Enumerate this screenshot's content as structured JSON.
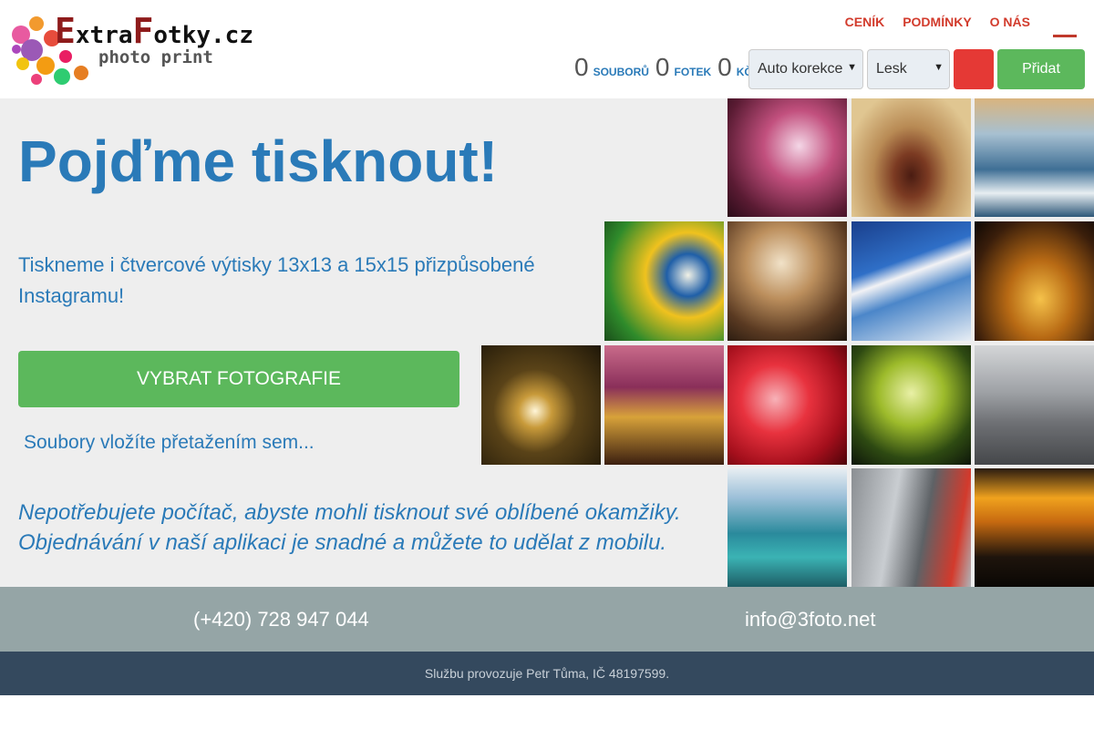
{
  "header": {
    "logo": {
      "wordmark_e": "E",
      "wordmark_xtra": "xtra",
      "wordmark_f": "F",
      "wordmark_rest": "otky.cz",
      "tagline": "photo print"
    },
    "nav": [
      {
        "label": "CENÍK"
      },
      {
        "label": "PODMÍNKY"
      },
      {
        "label": "O NÁS"
      }
    ],
    "counters": {
      "files_count": "0",
      "files_label": "SOUBORŮ",
      "photos_count": "0",
      "photos_label": "FOTEK",
      "price": "0",
      "currency": "KČ"
    },
    "correction_select": "Auto korekce",
    "finish_select": "Lesk",
    "color_swatch": "#e53935",
    "add_button": "Přidat"
  },
  "hero": {
    "title": "Pojďme tisknout!",
    "subtitle": "Tiskneme i čtvercové výtisky 13x13 a 15x15 přizpůsobené Instagramu!",
    "choose_button": "VYBRAT FOTOGRAFIE",
    "drop_hint": "Soubory vložíte přetažením sem...",
    "mobile_note_line1": "Nepotřebujete počítač, abyste mohli tisknout své oblíbené okamžiky.",
    "mobile_note_line2": "Objednávání v naší aplikaci je snadné a můžete to udělat z mobilu."
  },
  "contact": {
    "phone": "(+420) 728 947 044",
    "email": "info@3foto.net"
  },
  "footer": {
    "text": "Službu provozuje Petr Tůma, IČ 48197599."
  },
  "colors": {
    "primary_blue": "#2a7ab8",
    "green": "#5cb85c",
    "nav_red": "#d23b2c"
  }
}
